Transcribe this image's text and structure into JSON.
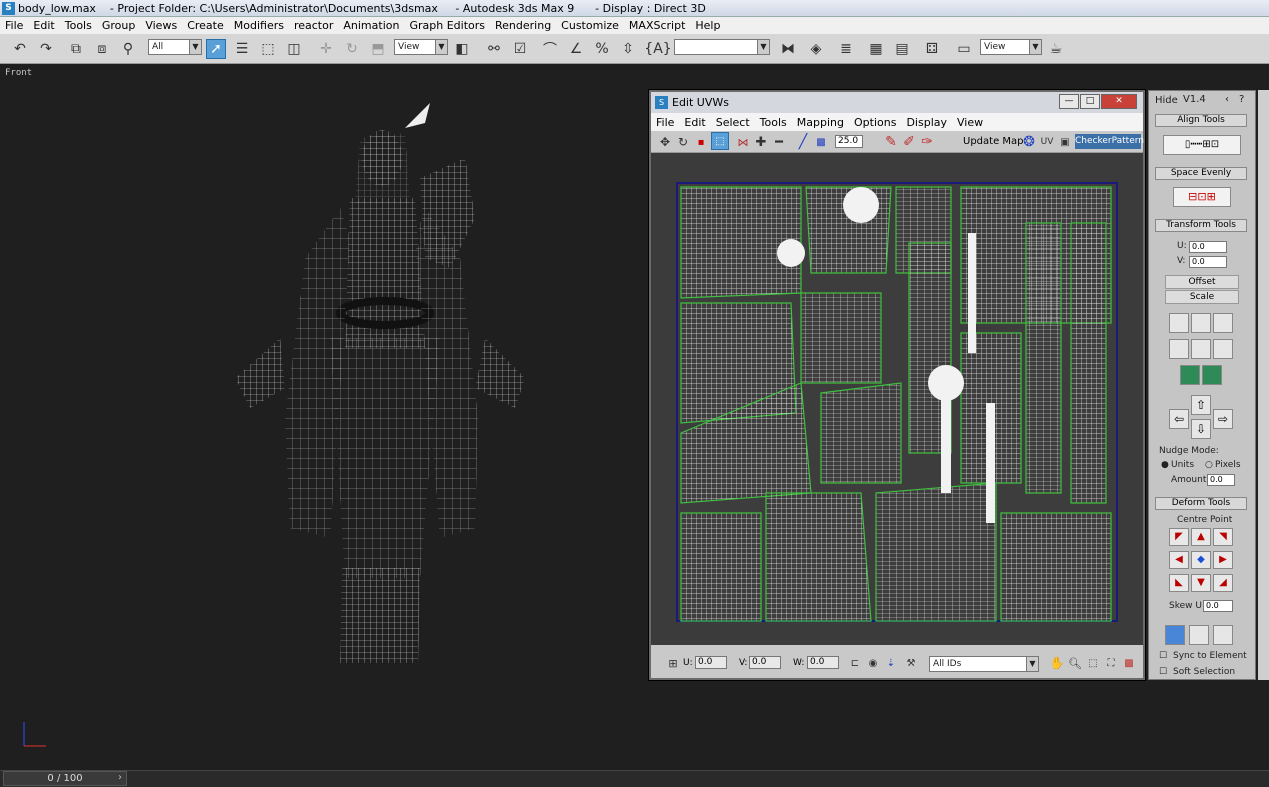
{
  "window": {
    "title": "body_low.max    - Project Folder: C:\\Users\\Administrator\\Documents\\3dsmax     - Autodesk 3ds Max 9      - Display : Direct 3D"
  },
  "menu": [
    "File",
    "Edit",
    "Tools",
    "Group",
    "Views",
    "Create",
    "Modifiers",
    "reactor",
    "Animation",
    "Graph Editors",
    "Rendering",
    "Customize",
    "MAXScript",
    "Help"
  ],
  "toolbar": {
    "selection_filter": "All",
    "ref_coord": "View",
    "named_sel": "",
    "view2": "View"
  },
  "viewport": {
    "label": "Front"
  },
  "timeslider": "0 / 100",
  "uvw": {
    "title": "Edit UVWs",
    "menu": [
      "File",
      "Edit",
      "Select",
      "Tools",
      "Mapping",
      "Options",
      "Display",
      "View"
    ],
    "zoom": "25.0",
    "update_map": "Update Map",
    "checker": "CheckerPattern",
    "u_label": "U:",
    "u_val": "0.0",
    "v_label": "V:",
    "v_val": "0.0",
    "w_label": "W:",
    "w_val": "0.0",
    "ids": "All IDs"
  },
  "panel": {
    "hide": "Hide",
    "version": "V1.4",
    "align_tools": "Align Tools",
    "space_evenly": "Space Evenly",
    "transform_tools": "Transform Tools",
    "u_label": "U:",
    "u_val": "0.0",
    "v_label": "V:",
    "v_val": "0.0",
    "offset": "Offset",
    "scale": "Scale",
    "nudge_mode": "Nudge Mode:",
    "units": "Units",
    "pixels": "Pixels",
    "amount": "Amount:",
    "amount_val": "0.0",
    "deform_tools": "Deform Tools",
    "centre_point": "Centre Point",
    "skew_u": "Skew U",
    "skew_val": "0.0",
    "sync": "Sync to Element",
    "soft": "Soft Selection"
  }
}
